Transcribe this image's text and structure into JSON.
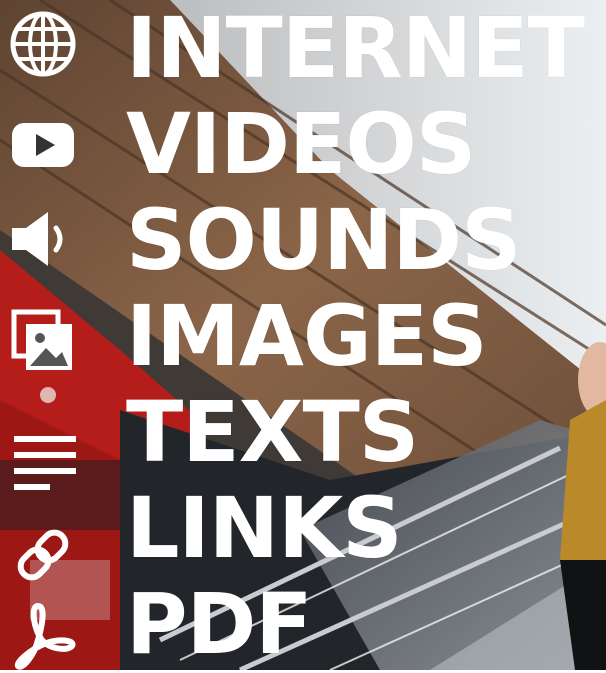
{
  "menu": {
    "items": [
      {
        "label": "INTERNET",
        "icon": "globe-icon"
      },
      {
        "label": "VIDEOS",
        "icon": "youtube-play-icon"
      },
      {
        "label": "SOUNDS",
        "icon": "speaker-icon"
      },
      {
        "label": "IMAGES",
        "icon": "images-icon"
      },
      {
        "label": "TEXTS",
        "icon": "text-lines-icon"
      },
      {
        "label": "LINKS",
        "icon": "link-icon"
      },
      {
        "label": "PDF",
        "icon": "pdf-icon"
      }
    ]
  },
  "colors": {
    "text": "#ffffff",
    "ceiling": "#7a5a3f",
    "red_panel": "#b51d1b",
    "wall": "#d9dadb",
    "glass": "#7b8088"
  }
}
